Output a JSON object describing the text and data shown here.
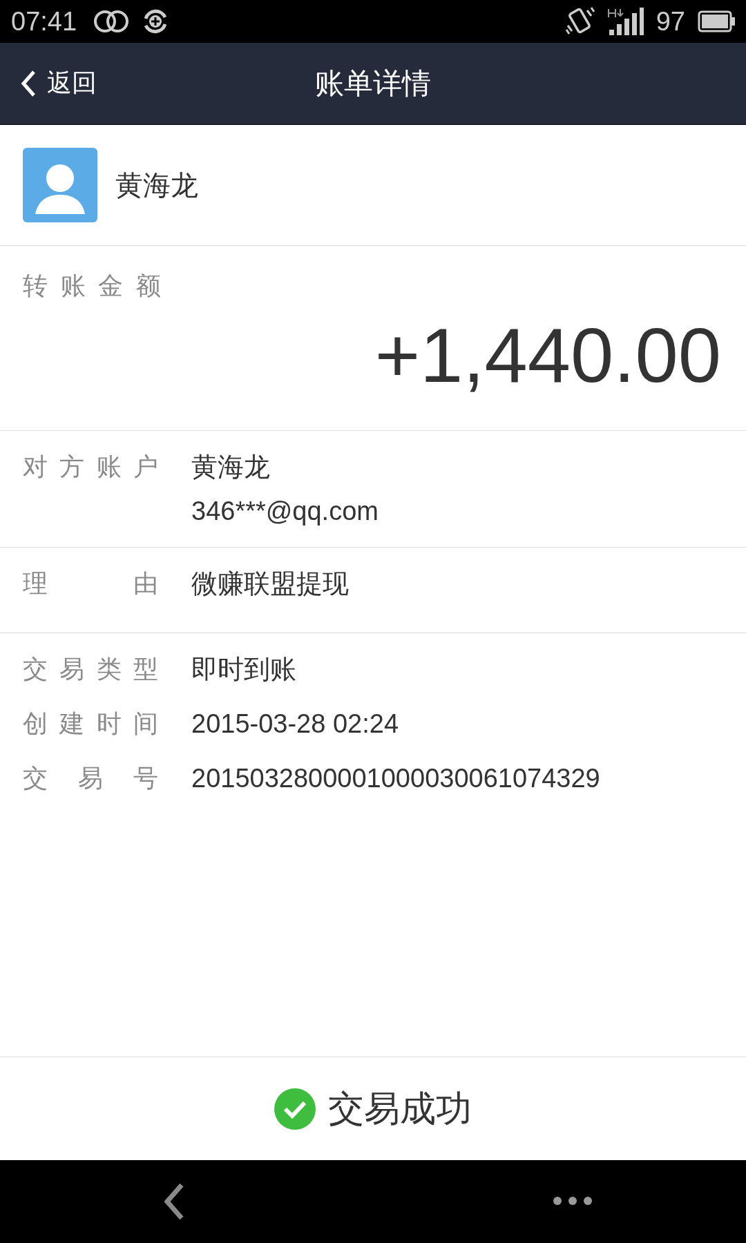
{
  "status_bar": {
    "time": "07:41",
    "battery": "97"
  },
  "header": {
    "back": "返回",
    "title": "账单详情"
  },
  "payee": {
    "name": "黄海龙"
  },
  "amount": {
    "label": "转账金额",
    "value": "+1,440.00"
  },
  "sections": [
    {
      "rows": [
        {
          "label": "对方账户",
          "lines": [
            "黄海龙",
            "346***@qq.com"
          ]
        }
      ]
    },
    {
      "rows": [
        {
          "label": "理由",
          "lines": [
            "微赚联盟提现"
          ]
        }
      ]
    },
    {
      "rows": [
        {
          "label": "交易类型",
          "lines": [
            "即时到账"
          ]
        },
        {
          "label": "创建时间",
          "lines": [
            "2015-03-28 02:24"
          ]
        },
        {
          "label": "交易号",
          "lines": [
            "2015032800001000030061074329"
          ]
        }
      ]
    }
  ],
  "result": {
    "text": "交易成功",
    "success": true
  }
}
